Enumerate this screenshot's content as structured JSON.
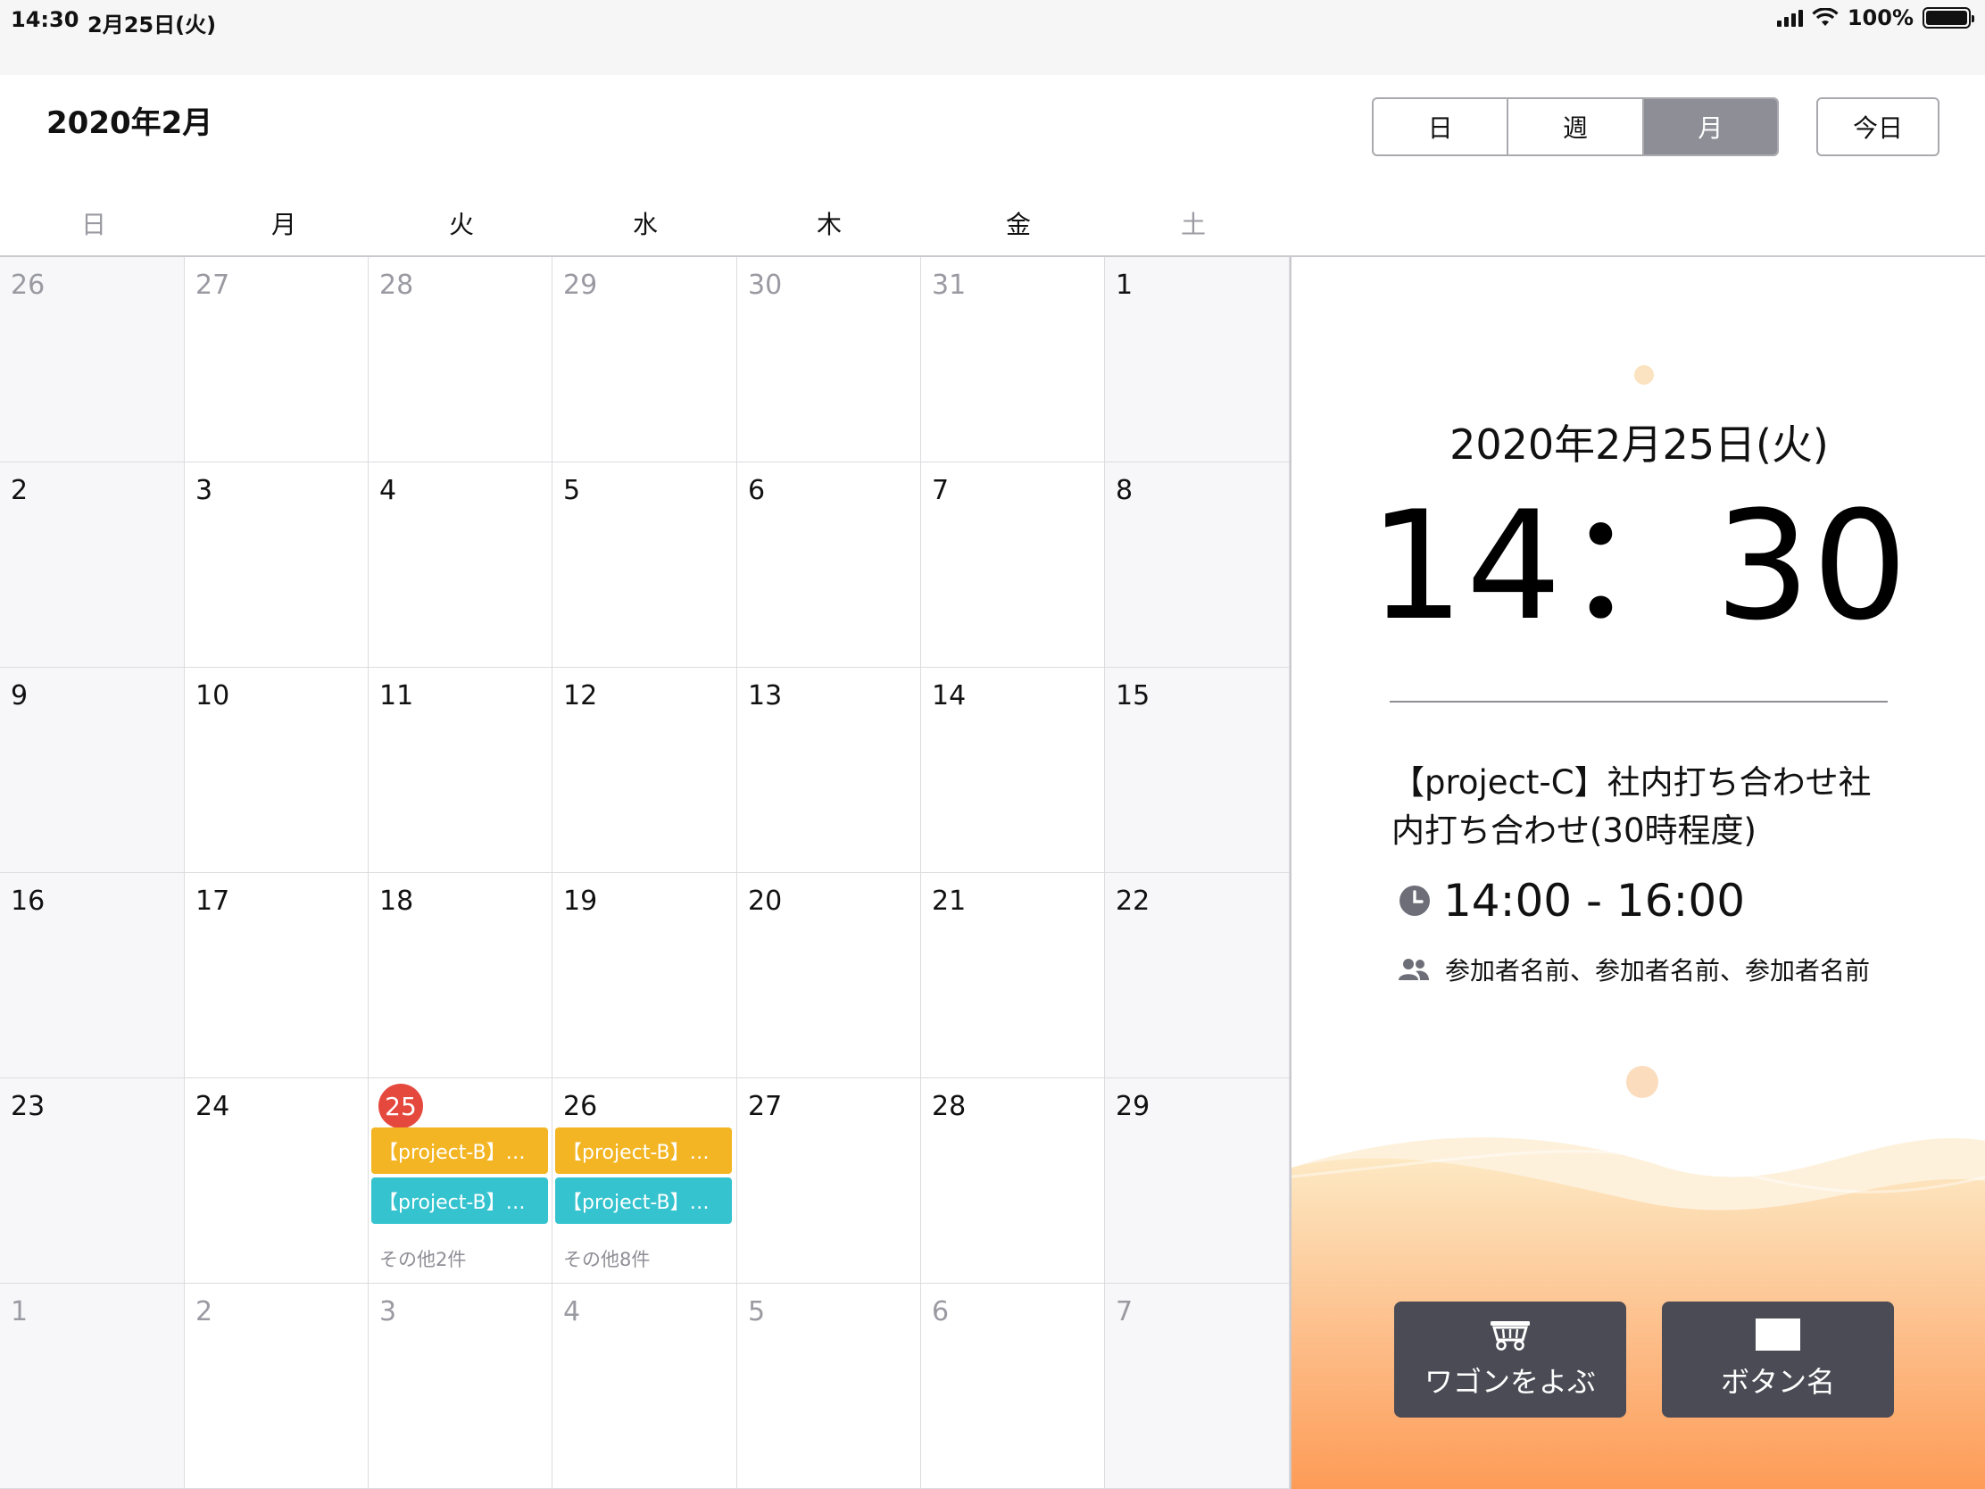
{
  "status_bar": {
    "time": "14:30",
    "date": "2月25日(火)",
    "battery": "100%"
  },
  "header": {
    "month_title": "2020年2月",
    "view_day": "日",
    "view_week": "週",
    "view_month": "月",
    "today_button": "今日"
  },
  "weekdays": [
    "日",
    "月",
    "火",
    "水",
    "木",
    "金",
    "土"
  ],
  "calendar": {
    "weeks": [
      [
        {
          "d": "26",
          "m": true
        },
        {
          "d": "27",
          "m": true
        },
        {
          "d": "28",
          "m": true
        },
        {
          "d": "29",
          "m": true
        },
        {
          "d": "30",
          "m": true
        },
        {
          "d": "31",
          "m": true
        },
        {
          "d": "1",
          "m": false
        }
      ],
      [
        {
          "d": "2",
          "m": false
        },
        {
          "d": "3",
          "m": false
        },
        {
          "d": "4",
          "m": false
        },
        {
          "d": "5",
          "m": false
        },
        {
          "d": "6",
          "m": false
        },
        {
          "d": "7",
          "m": false
        },
        {
          "d": "8",
          "m": false
        }
      ],
      [
        {
          "d": "9",
          "m": false
        },
        {
          "d": "10",
          "m": false
        },
        {
          "d": "11",
          "m": false
        },
        {
          "d": "12",
          "m": false
        },
        {
          "d": "13",
          "m": false
        },
        {
          "d": "14",
          "m": false
        },
        {
          "d": "15",
          "m": false
        }
      ],
      [
        {
          "d": "16",
          "m": false
        },
        {
          "d": "17",
          "m": false
        },
        {
          "d": "18",
          "m": false
        },
        {
          "d": "19",
          "m": false
        },
        {
          "d": "20",
          "m": false
        },
        {
          "d": "21",
          "m": false
        },
        {
          "d": "22",
          "m": false
        }
      ],
      [
        {
          "d": "23",
          "m": false
        },
        {
          "d": "24",
          "m": false
        },
        {
          "d": "25",
          "m": false,
          "today": true,
          "events": [
            {
              "label": "【project-B】…",
              "color": "#f3b523"
            },
            {
              "label": "【project-B】…",
              "color": "#35c3cf"
            }
          ],
          "more": "その他2件"
        },
        {
          "d": "26",
          "m": false,
          "events": [
            {
              "label": "【project-B】…",
              "color": "#f3b523"
            },
            {
              "label": "【project-B】…",
              "color": "#35c3cf"
            }
          ],
          "more": "その他8件"
        },
        {
          "d": "27",
          "m": false
        },
        {
          "d": "28",
          "m": false
        },
        {
          "d": "29",
          "m": false
        }
      ],
      [
        {
          "d": "1",
          "m": true
        },
        {
          "d": "2",
          "m": true
        },
        {
          "d": "3",
          "m": true
        },
        {
          "d": "4",
          "m": true
        },
        {
          "d": "5",
          "m": true
        },
        {
          "d": "6",
          "m": true
        },
        {
          "d": "7",
          "m": true
        }
      ]
    ]
  },
  "panel": {
    "date": "2020年2月25日(火)",
    "clock": "14：30",
    "event_title": "【project-C】社内打ち合わせ社内打ち合わせ(30時程度)",
    "event_time": "14:00 - 16:00",
    "participants": "参加者名前、参加者名前、参加者名前",
    "button_wagon": "ワゴンをよぶ",
    "button_other": "ボタン名"
  },
  "colors": {
    "today_accent": "#e5483d",
    "event_orange": "#f3b523",
    "event_teal": "#35c3cf",
    "panel_button": "#4b4b55"
  }
}
